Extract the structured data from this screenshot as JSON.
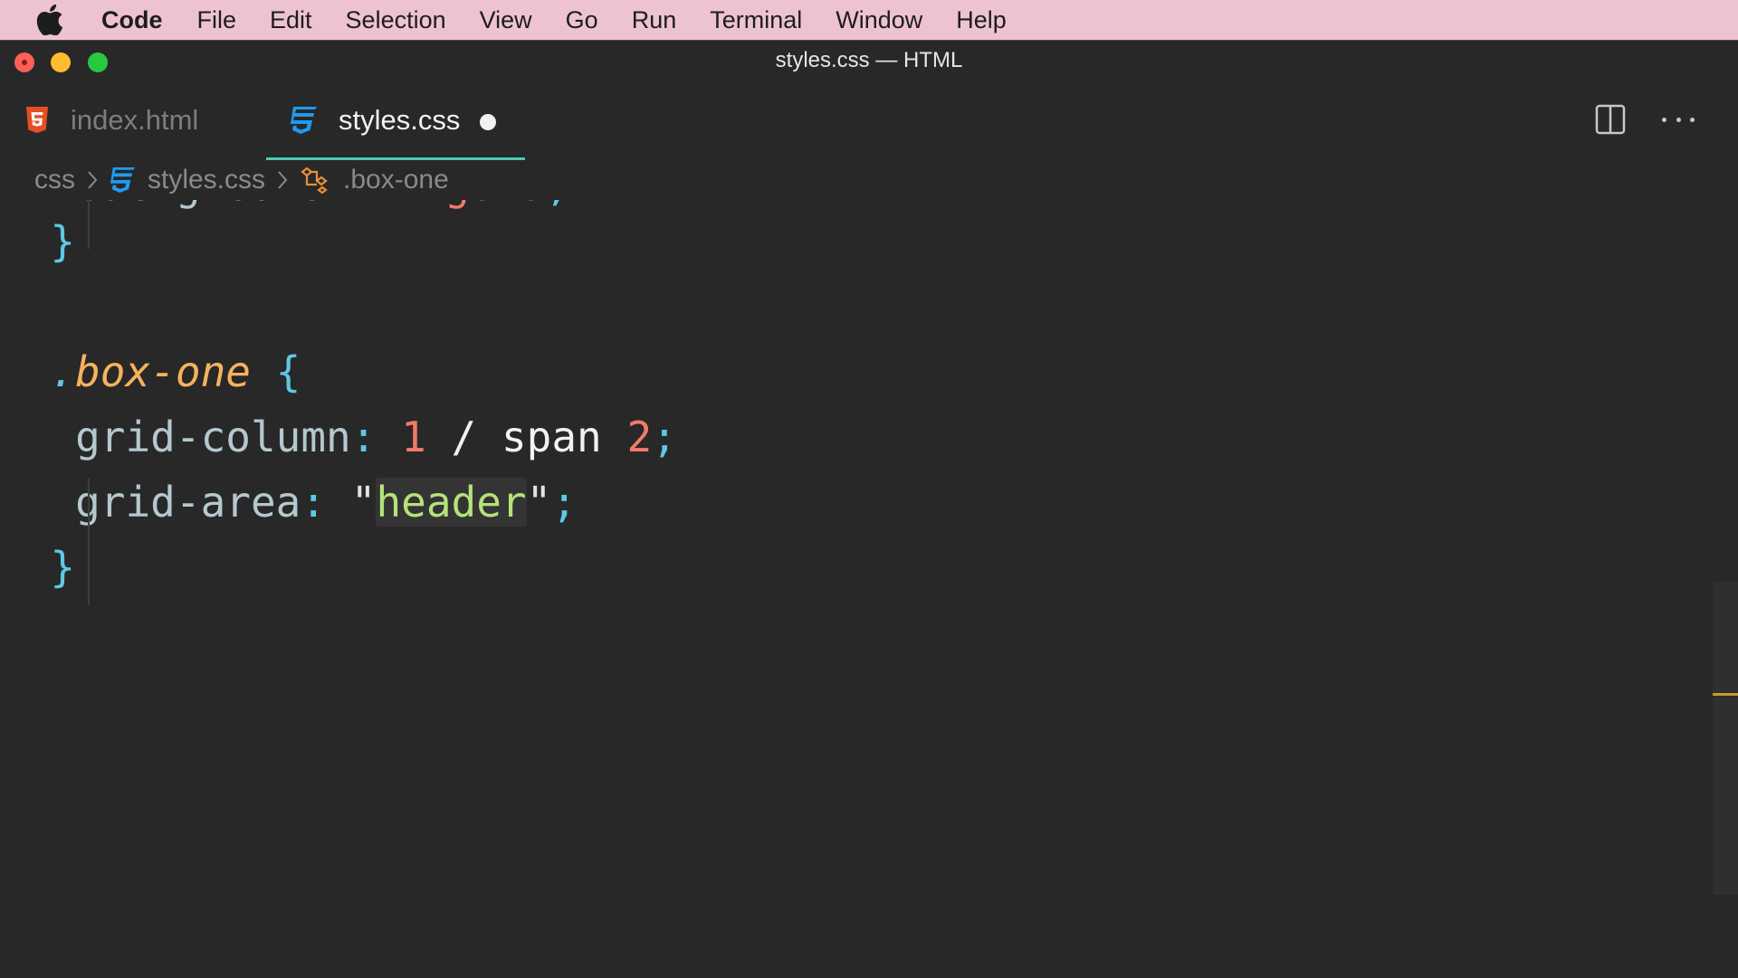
{
  "menubar": {
    "app_name": "Code",
    "items": [
      "File",
      "Edit",
      "Selection",
      "View",
      "Go",
      "Run",
      "Terminal",
      "Window",
      "Help"
    ]
  },
  "window": {
    "title": "styles.css — HTML"
  },
  "tabs": [
    {
      "label": "index.html",
      "icon": "html5-icon",
      "active": false
    },
    {
      "label": "styles.css",
      "icon": "css3-icon",
      "active": true,
      "dirty": true
    }
  ],
  "breadcrumb": {
    "folder": "css",
    "file": "styles.css",
    "symbol": ".box-one"
  },
  "code": {
    "line1": {
      "property": "background",
      "value": "gold"
    },
    "line2": {
      "brace": "}"
    },
    "line4": {
      "selector": "box-one"
    },
    "line5": {
      "property": "grid-column",
      "n1": "1",
      "slash": "/",
      "kw": "span",
      "n2": "2"
    },
    "line6": {
      "property": "grid-area",
      "string": "header"
    },
    "line7": {
      "brace": "}"
    }
  },
  "colors": {
    "accent_tab_underline": "#4ec9b0",
    "swatch_gold": "#ffd700",
    "menubar_bg": "#eec3d0"
  }
}
